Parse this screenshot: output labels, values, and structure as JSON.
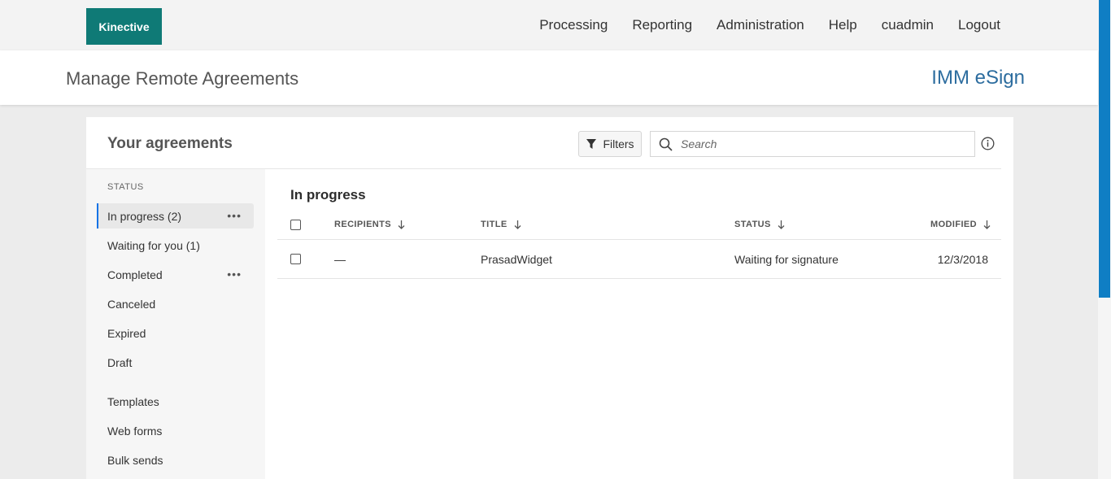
{
  "topnav": {
    "logo": "Kinective",
    "links": [
      "Processing",
      "Reporting",
      "Administration",
      "Help",
      "cuadmin",
      "Logout"
    ]
  },
  "header": {
    "page_title": "Manage Remote Agreements",
    "brand": "IMM eSign"
  },
  "card": {
    "title": "Your agreements",
    "filters_label": "Filters",
    "search_placeholder": "Search"
  },
  "sidebar": {
    "status_heading": "STATUS",
    "items": [
      {
        "label": "In progress (2)"
      },
      {
        "label": "Waiting for you (1)"
      },
      {
        "label": "Completed"
      },
      {
        "label": "Canceled"
      },
      {
        "label": "Expired"
      },
      {
        "label": "Draft"
      },
      {
        "label": "Templates"
      },
      {
        "label": "Web forms"
      },
      {
        "label": "Bulk sends"
      }
    ],
    "active_index": 0
  },
  "main": {
    "section_title": "In progress",
    "columns": [
      "RECIPIENTS",
      "TITLE",
      "STATUS",
      "MODIFIED"
    ],
    "rows": [
      {
        "recipients": "—",
        "title": "PrasadWidget",
        "status": "Waiting for signature",
        "modified": "12/3/2018"
      }
    ]
  },
  "colors": {
    "logo_bg": "#0f7a76",
    "brand_text": "#2d6d9f",
    "active_indicator": "#1473e6",
    "scrollbar_thumb": "#0f7ec4"
  }
}
